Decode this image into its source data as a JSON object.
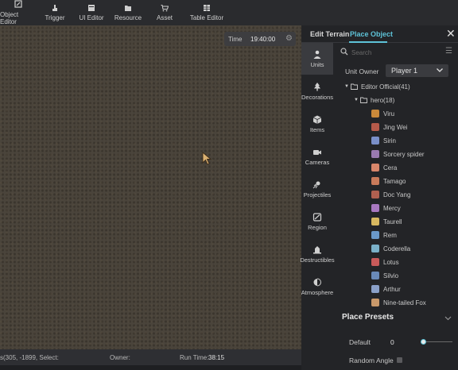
{
  "toolbar": {
    "items": [
      {
        "label": "Object Editor",
        "icon": "object-editor-icon"
      },
      {
        "label": "Trigger",
        "icon": "trigger-icon"
      },
      {
        "label": "UI Editor",
        "icon": "ui-editor-icon"
      },
      {
        "label": "Resource",
        "icon": "folder-icon"
      },
      {
        "label": "Asset",
        "icon": "cart-icon"
      },
      {
        "label": "Table Editor",
        "icon": "table-icon"
      }
    ]
  },
  "time": {
    "label": "Time",
    "value": "19:40:00"
  },
  "status": {
    "coords": "s(305, -1899, Select:",
    "owner_label": "Owner:",
    "runtime_label": "Run Time:",
    "runtime_value": "38:15"
  },
  "panel": {
    "tab_terrain": "Edit Terrain",
    "tab_place": "Place Object",
    "active_tab": "Place Object",
    "accent": "#5ec3d8",
    "categories": [
      {
        "label": "Units",
        "icon": "person-icon",
        "active": true
      },
      {
        "label": "Decorations",
        "icon": "tree-icon",
        "active": false
      },
      {
        "label": "Items",
        "icon": "cube-icon",
        "active": false
      },
      {
        "label": "Cameras",
        "icon": "camera-icon",
        "active": false
      },
      {
        "label": "Projectiles",
        "icon": "projectile-icon",
        "active": false
      },
      {
        "label": "Region",
        "icon": "region-icon",
        "active": false
      },
      {
        "label": "Destructibles",
        "icon": "destructible-icon",
        "active": false
      },
      {
        "label": "Atmosphere",
        "icon": "atmosphere-icon",
        "active": false
      }
    ],
    "search": {
      "placeholder": "Search",
      "value": ""
    },
    "owner": {
      "label": "Unit Owner",
      "value": "Player 1"
    },
    "tree": {
      "root": "Editor Official(41)",
      "folder": "hero(18)",
      "units": [
        {
          "name": "Viru",
          "color": "#c9893a"
        },
        {
          "name": "Jing Wei",
          "color": "#b55a4a"
        },
        {
          "name": "Sirin",
          "color": "#7a8fc8"
        },
        {
          "name": "Sorcery spider",
          "color": "#9a7ab0"
        },
        {
          "name": "Cera",
          "color": "#d8866a"
        },
        {
          "name": "Tamago",
          "color": "#c87a5a"
        },
        {
          "name": "Doc Yang",
          "color": "#b06050"
        },
        {
          "name": "Mercy",
          "color": "#a878c0"
        },
        {
          "name": "Taurell",
          "color": "#d8b860"
        },
        {
          "name": "Rem",
          "color": "#6a98c8"
        },
        {
          "name": "Coderella",
          "color": "#7ab0c8"
        },
        {
          "name": "Lotus",
          "color": "#c85a5a"
        },
        {
          "name": "Silvio",
          "color": "#6a8ab8"
        },
        {
          "name": "Arthur",
          "color": "#8aa0c8"
        },
        {
          "name": "Nine-tailed Fox",
          "color": "#c8986a"
        }
      ]
    },
    "presets": {
      "title": "Place Presets",
      "default_label": "Default",
      "default_value": "0",
      "random_angle_label": "Random Angle",
      "random_angle_checked": false
    }
  }
}
